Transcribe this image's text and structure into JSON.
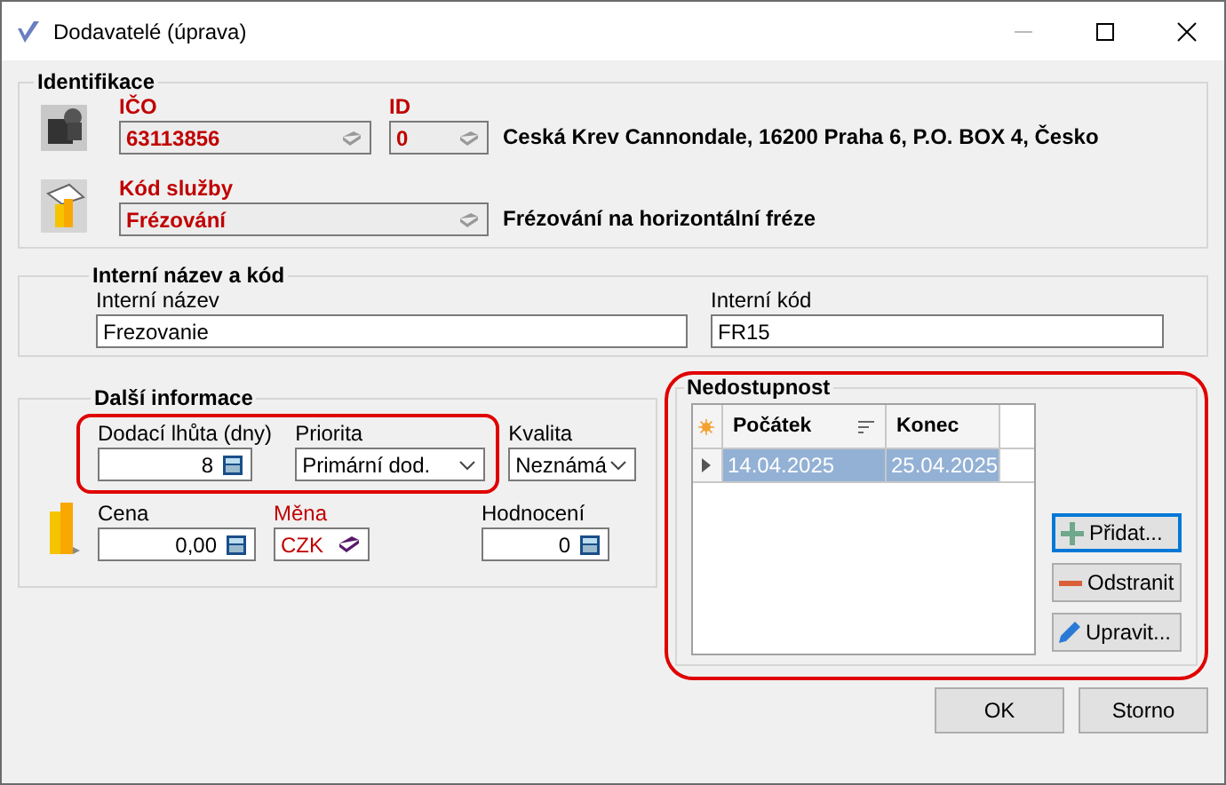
{
  "window": {
    "title": "Dodavatelé (úprava)"
  },
  "identification": {
    "title": "Identifikace",
    "ico": {
      "label": "IČO",
      "value": "63113856",
      "required": true
    },
    "id": {
      "label": "ID",
      "value": "0",
      "required": true
    },
    "supplier_text": "Ceská Krev Cannondale, 16200 Praha 6, P.O. BOX 4, Česko",
    "service_code": {
      "label": "Kód služby",
      "value": "Frézování",
      "required": true
    },
    "service_text": "Frézování na horizontální fréze"
  },
  "internal": {
    "title": "Interní název a kód",
    "name": {
      "label": "Interní název",
      "value": "Frezovanie"
    },
    "code": {
      "label": "Interní kód",
      "value": "FR15"
    }
  },
  "more": {
    "title": "Další informace",
    "highlighted": true,
    "delivery": {
      "label": "Dodací lhůta (dny)",
      "value": "8"
    },
    "priority": {
      "label": "Priorita",
      "value": "Primární dod."
    },
    "quality": {
      "label": "Kvalita",
      "value": "Neznámá"
    },
    "price": {
      "label": "Cena",
      "value": "0,00"
    },
    "currency": {
      "label": "Měna",
      "value": "CZK",
      "required": true
    },
    "rating": {
      "label": "Hodnocení",
      "value": "0"
    }
  },
  "unavailability": {
    "title": "Nedostupnost",
    "highlighted": true,
    "columns": [
      "Počátek",
      "Konec"
    ],
    "rows": [
      {
        "cells": [
          "14.04.2025",
          "25.04.2025"
        ],
        "selected": true
      }
    ],
    "buttons": [
      {
        "label": "Přidat...",
        "kind": "add",
        "focused": true
      },
      {
        "label": "Odstranit",
        "kind": "remove",
        "focused": false
      },
      {
        "label": "Upravit...",
        "kind": "edit",
        "focused": false
      }
    ]
  },
  "buttons": [
    "OK",
    "Storno"
  ]
}
